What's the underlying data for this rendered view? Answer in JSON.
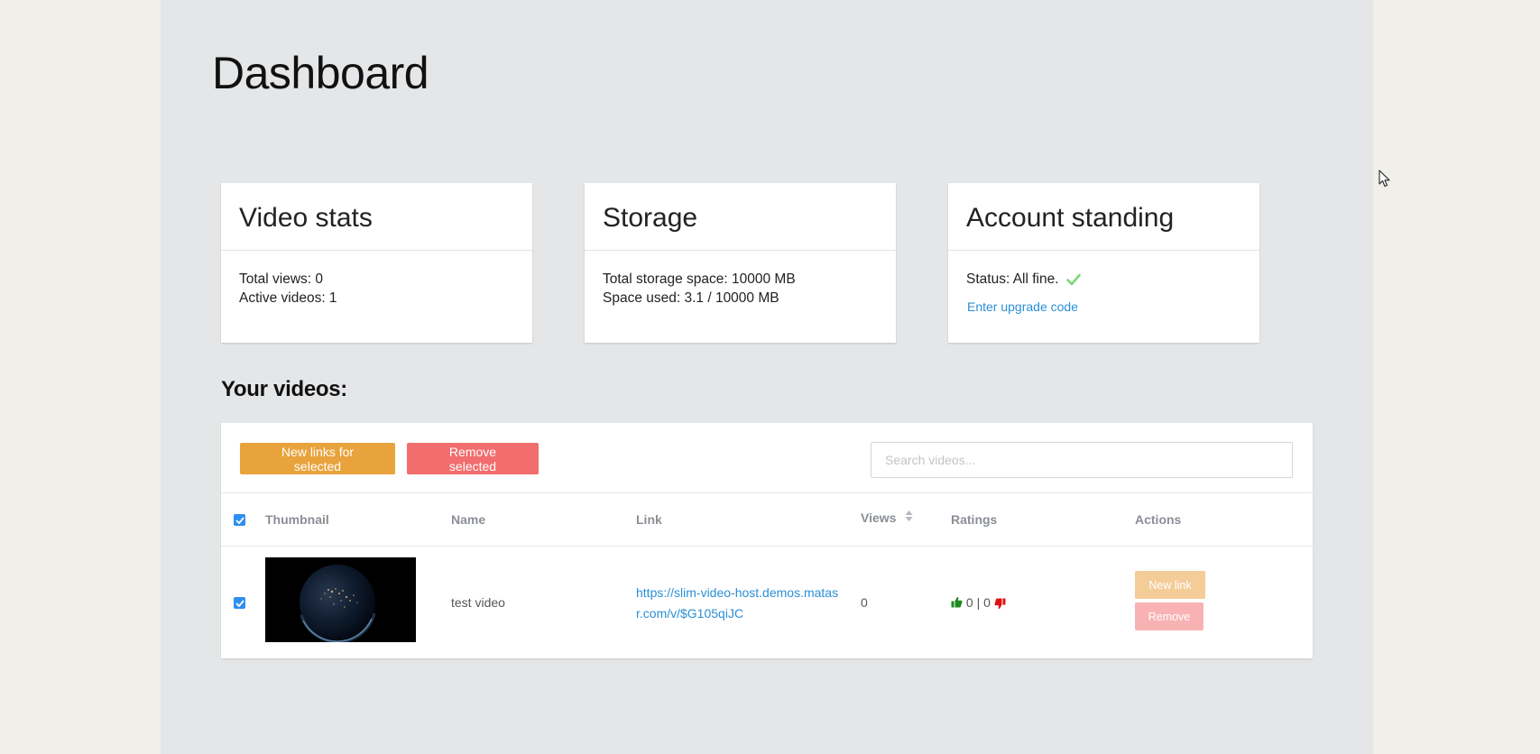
{
  "page": {
    "title": "Dashboard"
  },
  "cards": {
    "video_stats": {
      "title": "Video stats",
      "total_views": "Total views: 0",
      "active_videos": "Active videos: 1"
    },
    "storage": {
      "title": "Storage",
      "total_space": "Total storage space: 10000 MB",
      "space_used": "Space used: 3.1 / 10000 MB"
    },
    "account": {
      "title": "Account standing",
      "status": "Status: All fine.",
      "upgrade_link": "Enter upgrade code"
    }
  },
  "videos": {
    "section_title": "Your videos:",
    "toolbar": {
      "new_links_label": "New links for selected",
      "remove_label": "Remove selected",
      "search_placeholder": "Search videos..."
    },
    "columns": {
      "thumbnail": "Thumbnail",
      "name": "Name",
      "link": "Link",
      "views": "Views",
      "ratings": "Ratings",
      "actions": "Actions"
    },
    "rows": [
      {
        "name": "test video",
        "link": "https://slim-video-host.demos.matasr.com/v/$G105qiJC",
        "views": "0",
        "ratings": "0 | 0",
        "new_link_label": "New link",
        "remove_label": "Remove"
      }
    ]
  },
  "colors": {
    "accent_orange": "#e8a33c",
    "accent_red": "#f26d6d",
    "link_blue": "#2b8fd6",
    "checkbox_blue": "#2f8ff0",
    "thumbs_up": "#1e8a1e",
    "thumbs_down": "#e01010"
  },
  "icons": [
    "check-icon",
    "sort-icon",
    "thumbs-up-icon",
    "thumbs-down-icon",
    "mouse-cursor-icon"
  ]
}
